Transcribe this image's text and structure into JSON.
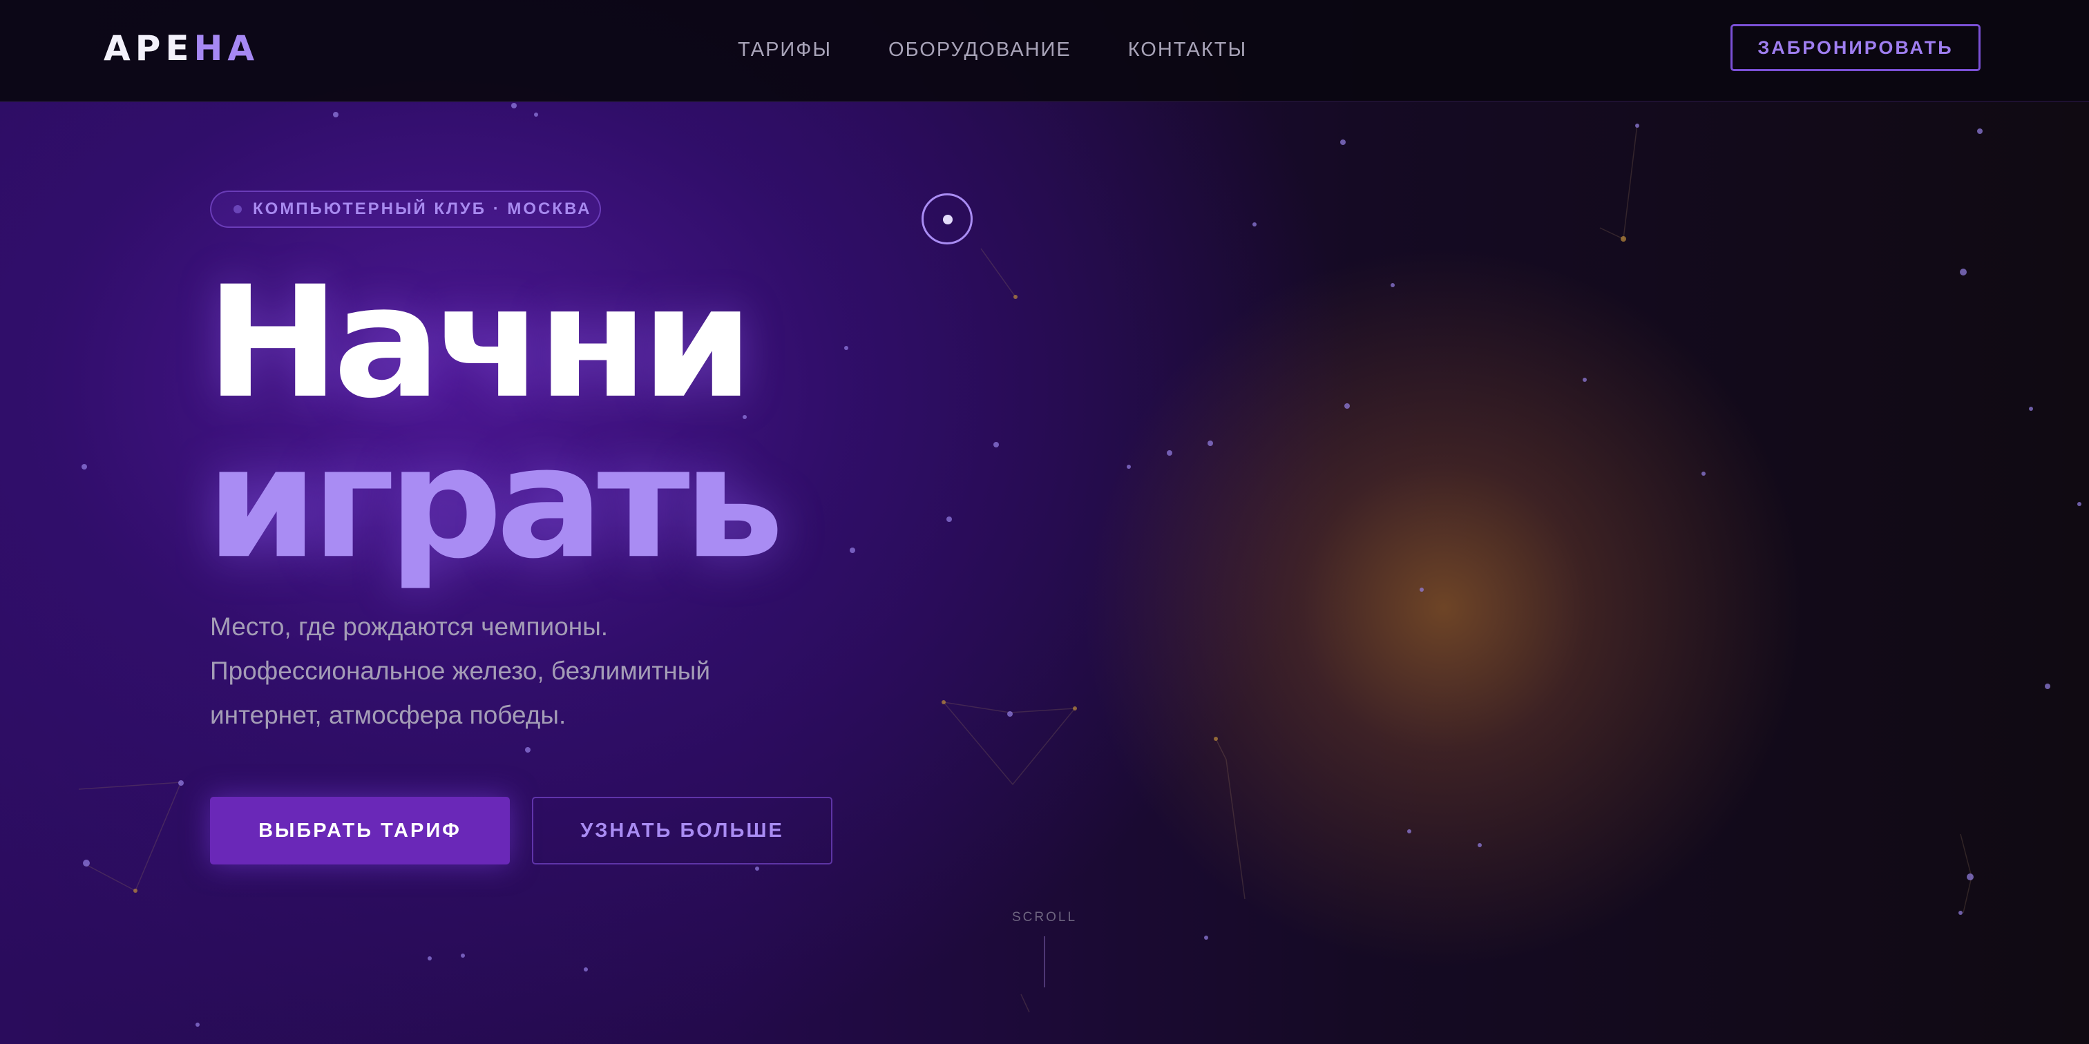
{
  "logo": {
    "part1": "АРЕ",
    "part2": "НА"
  },
  "nav": {
    "items": [
      "ТАРИФЫ",
      "ОБОРУДОВАНИЕ",
      "КОНТАКТЫ"
    ]
  },
  "cta_book": "ЗАБРОНИРОВАТЬ",
  "hero": {
    "badge": "КОМПЬЮТЕРНЫЙ КЛУБ · МОСКВА",
    "title_line1": "Начни",
    "title_line2": "играть",
    "subtitle_line1": "Место, где рождаются чемпионы.",
    "subtitle_line2": "Профессиональное железо, безлимитный",
    "subtitle_line3": "интернет, атмосфера победы.",
    "primary_button": "ВЫБРАТЬ ТАРИФ",
    "secondary_button": "УЗНАТЬ БОЛЬШЕ"
  },
  "scroll_label": "SCROLL",
  "colors": {
    "accent": "#a98cf3",
    "primary_button_bg": "#6a28b8",
    "background": "#0b0710",
    "glow_orange": "#8c5828"
  },
  "icons": {
    "custom_cursor": "ring-cursor-icon"
  }
}
